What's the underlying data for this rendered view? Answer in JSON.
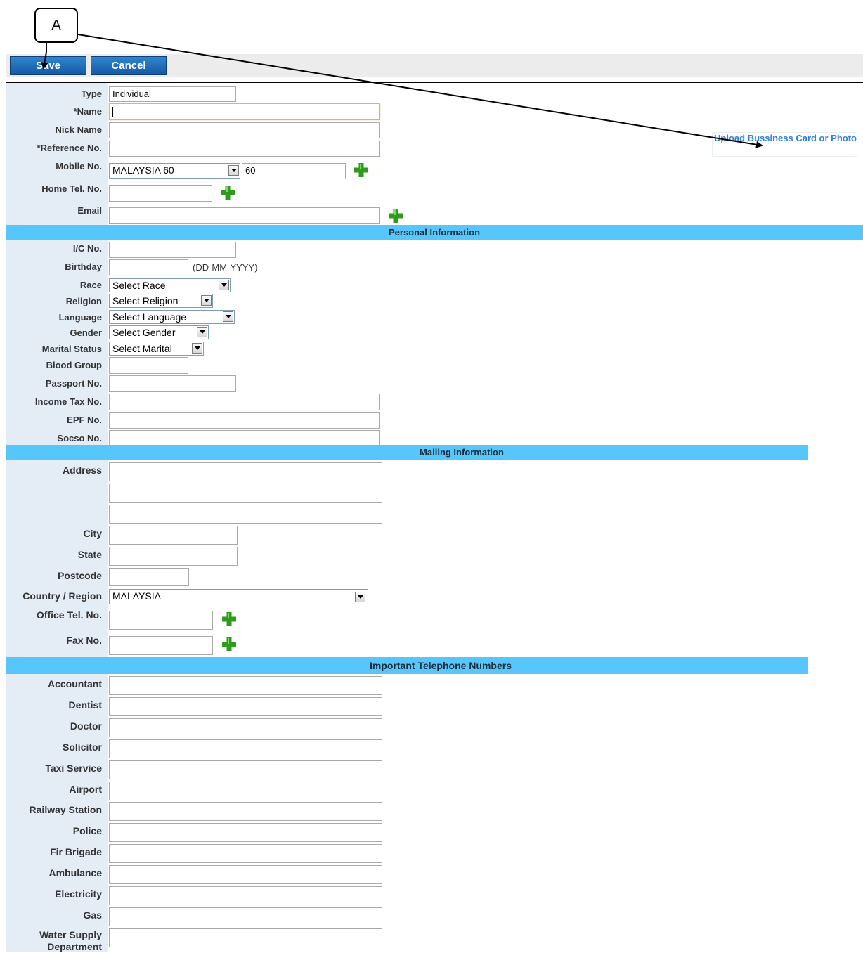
{
  "callout": {
    "label": "A"
  },
  "toolbar": {
    "save_label": "Save",
    "cancel_label": "Cancel"
  },
  "upload_link": "Upload Bussiness Card or Photo",
  "contact": {
    "type_label": "Type",
    "type_value": "Individual",
    "name_label": "*Name",
    "nick_label": "Nick Name",
    "ref_label": "*Reference No.",
    "mobile_label": "Mobile No.",
    "mobile_country": "MALAYSIA 60",
    "mobile_code": "60",
    "home_label": "Home Tel. No.",
    "email_label": "Email"
  },
  "personal": {
    "header": "Personal Information",
    "ic_label": "I/C No.",
    "birthday_label": "Birthday",
    "birthday_hint": "(DD-MM-YYYY)",
    "race_label": "Race",
    "race_value": "Select Race",
    "religion_label": "Religion",
    "religion_value": "Select Religion",
    "language_label": "Language",
    "language_value": "Select Language",
    "gender_label": "Gender",
    "gender_value": "Select Gender",
    "marital_label": "Marital Status",
    "marital_value": "Select Marital",
    "blood_label": "Blood Group",
    "passport_label": "Passport No.",
    "tax_label": "Income Tax No.",
    "epf_label": "EPF No.",
    "socso_label": "Socso No."
  },
  "mailing": {
    "header": "Mailing Information",
    "address_label": "Address",
    "city_label": "City",
    "state_label": "State",
    "postcode_label": "Postcode",
    "country_label": "Country / Region",
    "country_value": "MALAYSIA",
    "office_label": "Office Tel. No.",
    "fax_label": "Fax No."
  },
  "important": {
    "header": "Important Telephone Numbers",
    "items": [
      "Accountant",
      "Dentist",
      "Doctor",
      "Solicitor",
      "Taxi Service",
      "Airport",
      "Railway Station",
      "Police",
      "Fir Brigade",
      "Ambulance",
      "Electricity",
      "Gas",
      "Water Supply Department"
    ]
  },
  "colors": {
    "band": "#57c7fb",
    "label_col": "#e4ecf6",
    "button": "#1f6fbf",
    "link": "#2f7fd8",
    "plus": "#2e9a1e"
  },
  "icons": [
    "plus-icon",
    "dropdown-arrow-icon"
  ]
}
